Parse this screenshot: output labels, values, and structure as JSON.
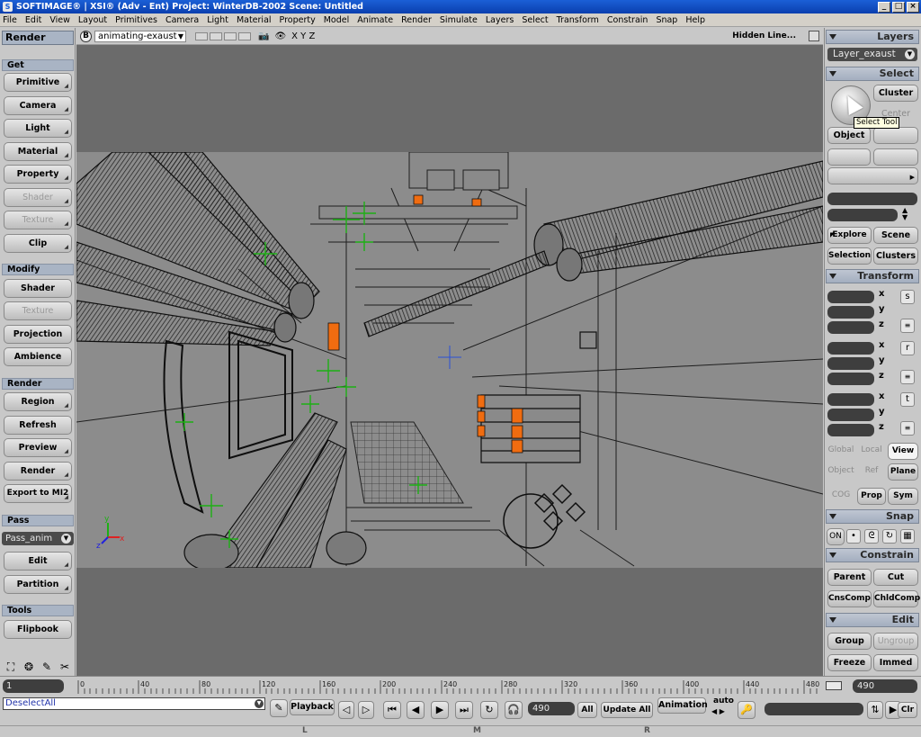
{
  "window": {
    "title": "SOFTIMAGE® | XSI® (Adv - Ent) Project: WinterDB-2002    Scene: Untitled",
    "controls": [
      "_",
      "□",
      "×"
    ]
  },
  "menu": [
    "File",
    "Edit",
    "View",
    "Layout",
    "Primitives",
    "Camera",
    "Light",
    "Material",
    "Property",
    "Model",
    "Animate",
    "Render",
    "Simulate",
    "Layers",
    "Select",
    "Transform",
    "Constrain",
    "Snap",
    "Help"
  ],
  "left_panel": {
    "title": "Render",
    "sections": {
      "get": "Get",
      "modify": "Modify",
      "render": "Render",
      "pass": "Pass",
      "tools": "Tools"
    },
    "get_buttons": [
      "Primitive",
      "Camera",
      "Light",
      "Material",
      "Property",
      "Shader",
      "Texture",
      "Clip"
    ],
    "modify_buttons": [
      "Shader",
      "Texture",
      "Projection",
      "Ambience"
    ],
    "render_buttons": [
      "Region",
      "Refresh",
      "Preview",
      "Render",
      "Export to MI2"
    ],
    "pass_select": "Pass_anim",
    "pass_buttons": [
      "Edit",
      "Partition"
    ],
    "tools_buttons": [
      "Flipbook"
    ],
    "icons": [
      "select-icon",
      "paint-icon",
      "brush-icon",
      "knife-icon"
    ]
  },
  "viewport": {
    "letter": "B",
    "camera": "animating-exaust",
    "axes": "X Y Z",
    "mode": "Hidden Line..."
  },
  "right_panel": {
    "layers_header": "Layers",
    "layer_select": "Layer_exaust",
    "select_header": "Select",
    "tooltip": "Select Tool",
    "select_buttons": {
      "cluster": "Cluster",
      "center": "Center",
      "object": "Object"
    },
    "explore": "Explore",
    "scene": "Scene",
    "selection": "Selection",
    "clusters": "Clusters",
    "transform_header": "Transform",
    "axes": [
      "x",
      "y",
      "z"
    ],
    "transform_icons": [
      "s",
      "r",
      "t"
    ],
    "mode_row1": [
      "Global",
      "Local",
      "View"
    ],
    "mode_row2": [
      "Object",
      "Ref",
      "Plane"
    ],
    "mode_row3": [
      "COG",
      "Prop",
      "Sym"
    ],
    "snap_header": "Snap",
    "snap_on": "ON",
    "constrain_header": "Constrain",
    "constrain_buttons": [
      "Parent",
      "Cut",
      "CnsComp",
      "ChldComp"
    ],
    "edit_header": "Edit",
    "edit_buttons": [
      "Group",
      "Ungroup",
      "Freeze",
      "Immed"
    ]
  },
  "timeline": {
    "start": "1",
    "end": "490",
    "ticks": [
      "0",
      "40",
      "80",
      "120",
      "160",
      "200",
      "240",
      "280",
      "320",
      "360",
      "400",
      "440",
      "480"
    ]
  },
  "bottom": {
    "command": "DeselectAll",
    "playback": "Playback",
    "current_frame": "490",
    "all": "All",
    "update_all": "Update All",
    "animation": "Animation",
    "auto": "auto",
    "clr": "Clr"
  },
  "status": [
    "L",
    "M",
    "R"
  ],
  "colors": {
    "accent_orange": "#f06c10",
    "null_green": "#1db014",
    "header_blue": "#a9b4c4"
  }
}
